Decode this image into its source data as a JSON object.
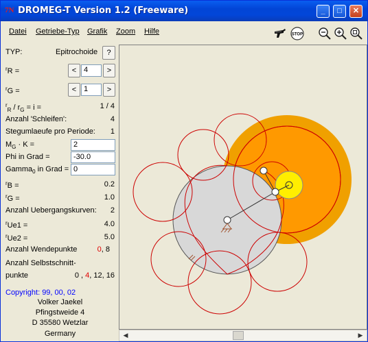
{
  "window": {
    "app_icon": "7N",
    "title": "DROMEG-T Version 1.2 (Freeware)"
  },
  "titlebar_buttons": {
    "minimize": "_",
    "maximize": "□",
    "close": "✕"
  },
  "menu": [
    {
      "label": "Datei"
    },
    {
      "label": "Getriebe-Typ"
    },
    {
      "label": "Grafik"
    },
    {
      "label": "Zoom"
    },
    {
      "label": "Hilfe"
    }
  ],
  "toolbar": {
    "stop_label": "STOP",
    "icons": [
      "pistol-icon",
      "stop-icon",
      "zoom-out-icon",
      "zoom-in-icon",
      "zoom-fit-icon"
    ]
  },
  "params": {
    "typ_label": "TYP:",
    "typ_value": "Epitrochoide",
    "help_label": "?",
    "rR_label": "=",
    "rR_value": "4",
    "rG_label": "=",
    "rG_value": "1",
    "dec_label": "<",
    "inc_label": ">",
    "ratio_label": "/ r",
    "ratio_eq": "= i =",
    "ratio_value": "1  /  4",
    "schleifen_label": "Anzahl 'Schleifen':",
    "schleifen_value": "4",
    "stegumlaeufe_label": "Stegumlaeufe pro Periode:",
    "stegumlaeufe_value": "1",
    "mgk_label": "· K =",
    "mgk_value": "2",
    "phi_label": "Phi in Grad  =",
    "phi_value": "-30.0",
    "gamma_label": "in Grad =",
    "gamma_value": "0",
    "rB_label": "=",
    "rB_value": "0.2",
    "rG2_label": "=",
    "rG2_value": "1.0",
    "ueberg_label": "Anzahl Uebergangskurven:",
    "ueberg_value": "2",
    "rUe1_label": "=",
    "rUe1_value": "4.0",
    "rUe2_label": "=",
    "rUe2_value": "5.0",
    "wende_label": "Anzahl Wendepunkte",
    "wende_value_a": "0",
    "wende_value_b": ", 8",
    "selbst_label_1": "Anzahl Selbstschnitt-",
    "selbst_label_2": "punkte",
    "selbst_value_a": "0 ,",
    "selbst_value_b": "4",
    "selbst_value_c": ", 12, 16"
  },
  "sym": {
    "r": "r",
    "R": "R",
    "G": "G",
    "M": "M",
    "Gamma": "Gamma",
    "B": "B",
    "Ue1": "Ue1",
    "Ue2": "Ue2",
    "zero": "0"
  },
  "footer": {
    "copyright": "Copyright: 99, 00, 02",
    "author": "Volker Jaekel",
    "street": "Pfingstweide 4",
    "city": "D 35580 Wetzlar",
    "country": "Germany"
  },
  "colors": {
    "title_blue": "#0245D6",
    "fixed_circle": "#D8D8D8",
    "large_orange": "#F0A000",
    "inner_orange": "#FF9900",
    "small_yellow": "#FFEE00",
    "curve_red": "#CC0000",
    "link_blue": "#0000FF",
    "accent_red": "#E00000"
  }
}
